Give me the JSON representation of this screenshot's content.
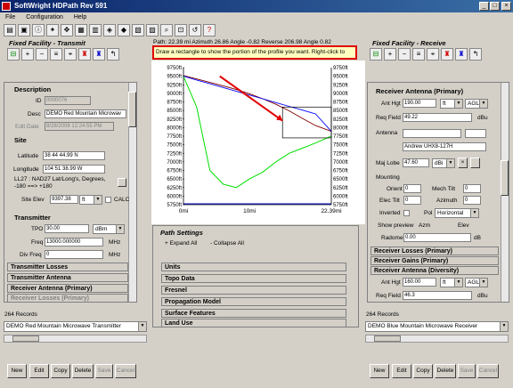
{
  "window": {
    "title": "SoftWright HDPath Rev 591"
  },
  "menu": [
    "File",
    "Configuration",
    "Help"
  ],
  "tx": {
    "header": "Fixed Facility - Transmit",
    "description": {
      "label": "Description",
      "id_label": "ID",
      "id_value": "0000076",
      "desc_label": "Desc",
      "desc_value": "DEMO Red Mountain Microwav",
      "edit_label": "Edit Date",
      "edit_value": "8/28/2008 12:24:55 PM"
    },
    "site": {
      "label": "Site",
      "lat_label": "Latitude",
      "lat_value": "38 44 44.99 N",
      "lon_label": "Longitude",
      "lon_value": "104 51 38.99 W",
      "datum": "LL27 : NAD27 Lat/Long's, Degrees, -180 ==> +180",
      "elev_label": "Site Elev",
      "elev_value": "9397.38",
      "elev_unit": "ft",
      "calc": "CALC"
    },
    "transmitter": {
      "label": "Transmitter",
      "tpo_label": "TPO",
      "tpo_value": "30.00",
      "tpo_unit": "dBm",
      "freq_label": "Freq",
      "freq_value": "13000.000000",
      "freq_unit": "MHz",
      "divfreq_label": "Div Freq",
      "divfreq_value": "0",
      "divfreq_unit": "MHz"
    },
    "sections": [
      "Transmitter Losses",
      "Transmitter Antenna",
      "Receiver Antenna (Primary)",
      "Receiver Losses (Primary)"
    ],
    "records": "264 Records",
    "record_value": "DEMO Red Mountain Microwave Transmitter",
    "buttons": [
      "New",
      "Edit",
      "Copy",
      "Delete",
      "Save",
      "Cancel"
    ]
  },
  "path_info": "Path: 22.39 mi  Azimuth 26.86  Angle -0.82  Reverse 206.98  Angle 0.82",
  "tooltip": "Draw a rectangle to show the portion of the profile you want. Right-click to",
  "chart_data": {
    "type": "line",
    "x": [
      0,
      2,
      4,
      6,
      8,
      10,
      12,
      14,
      16,
      18,
      20,
      22.39
    ],
    "series": [
      {
        "values": [
          9497,
          8600,
          6750,
          6350,
          6250,
          6500,
          6700,
          7000,
          7250,
          7400,
          7550,
          7750
        ]
      },
      {
        "values": [
          9520,
          9420,
          9320,
          9220,
          9110,
          8990,
          8840,
          8680,
          8490,
          8270,
          8060,
          7890
        ]
      },
      {
        "values": [
          9500,
          9390,
          9280,
          9170,
          9060,
          8950,
          8840,
          8730,
          8620,
          8510,
          8400,
          7890
        ]
      }
    ],
    "ylim": [
      5750,
      9750
    ],
    "xlim": [
      0,
      22.39
    ],
    "yticks_left": [
      "9750ft",
      "9500ft",
      "9250ft",
      "9000ft",
      "8750ft",
      "8500ft",
      "8250ft",
      "8000ft",
      "7750ft",
      "7500ft",
      "7250ft",
      "7000ft",
      "6750ft",
      "6500ft",
      "6250ft",
      "6000ft",
      "5750ft"
    ],
    "yticks_right": [
      "9750ft",
      "9500ft",
      "9250ft",
      "9000ft",
      "8750ft",
      "8500ft",
      "8250ft",
      "8000ft",
      "7750ft",
      "7500ft",
      "7250ft",
      "7000ft",
      "6750ft",
      "6500ft",
      "6250ft",
      "6000ft",
      "5750ft"
    ],
    "xticks": [
      "0mi",
      "10mi",
      "22.39mi"
    ],
    "colors": {
      "terrain": "#00e000",
      "los": "#800000",
      "fresnel": "#0000ff",
      "arrow": "#e00000"
    }
  },
  "path_settings": {
    "header": "Path Settings",
    "expand": "+ Expand All",
    "collapse": "- Collapse All",
    "sections": [
      "Units",
      "Topo Data",
      "Fresnel",
      "Propagation Model",
      "Surface Features",
      "Land Use"
    ]
  },
  "rx": {
    "header": "Fixed Facility - Receive",
    "antenna": {
      "label": "Receiver Antenna (Primary)",
      "hgt_label": "Ant Hgt",
      "hgt_value": "190.00",
      "hgt_unit": "ft",
      "hgt_ref": "AGL",
      "req_label": "Req Field",
      "req_value": "49.22",
      "req_unit": "dBu",
      "ant_label": "Antenna",
      "ant_value": "Andrew UHX8-127H",
      "lobe_label": "Maj Lobe",
      "lobe_value": "47.60",
      "lobe_unit": "dBi",
      "mount_label": "Mounting",
      "orient_label": "Orient",
      "orient_value": "0",
      "mtilt_label": "Mech Tilt",
      "mtilt_value": "0",
      "etilt_label": "Elec Tilt",
      "etilt_value": "0",
      "az_label": "Azimuth",
      "az_value": "0",
      "inv_label": "Inverted",
      "pol_label": "Pol",
      "pol_value": "Horizontal",
      "preview_label": "Show preview",
      "azm_label": "Azm",
      "elev_label": "Elev",
      "radome_label": "Radome",
      "radome_value": "0.00",
      "radome_unit": "dB"
    },
    "sections": [
      "Receiver Losses (Primary)",
      "Receiver Gains (Primary)",
      "Receiver Antenna (Diversity)"
    ],
    "div": {
      "hgt_value": "160.00",
      "hgt_unit": "ft",
      "hgt_ref": "AGL",
      "req_value": "46.3",
      "req_unit": "dBu"
    },
    "records": "264 Records",
    "record_value": "DEMO Blue Mountain Microwave Receiver",
    "buttons": [
      "New",
      "Edit",
      "Copy",
      "Delete",
      "Save",
      "Cancel"
    ]
  }
}
